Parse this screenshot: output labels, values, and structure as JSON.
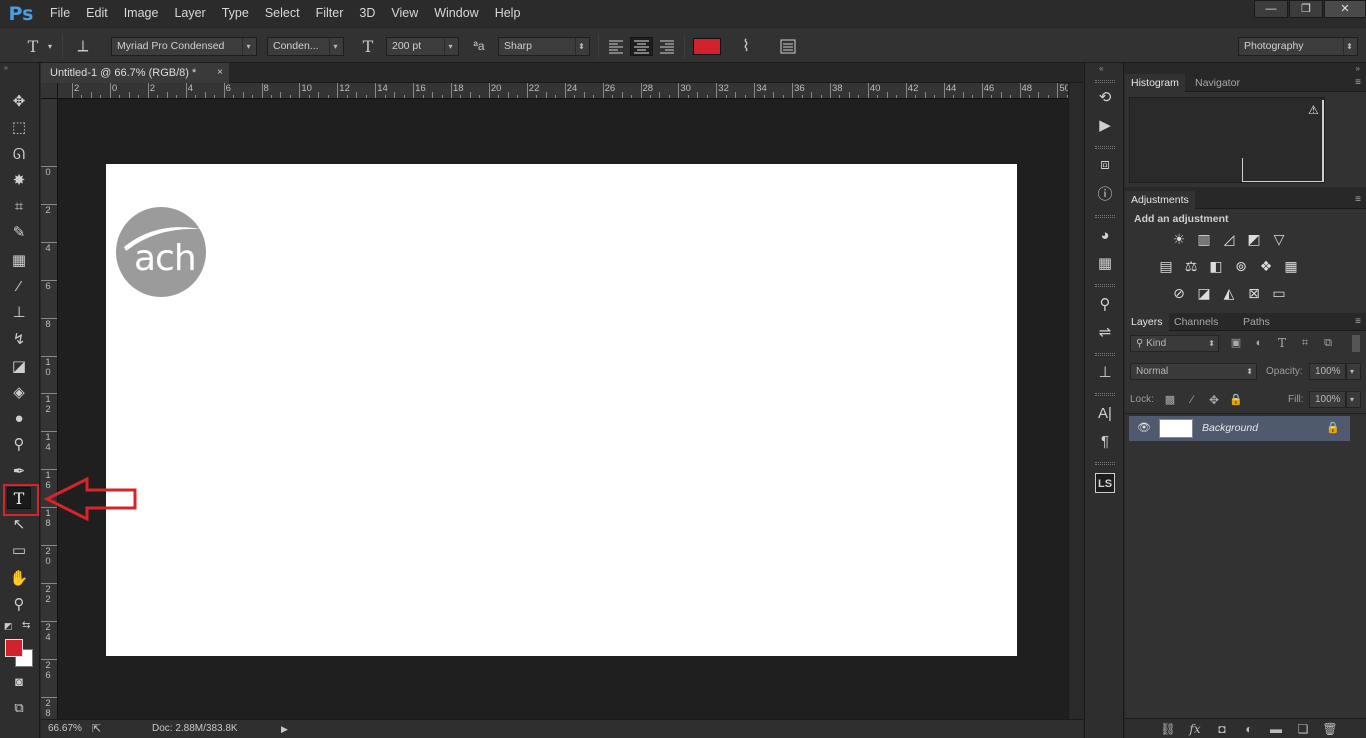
{
  "app": {
    "logo": "Ps",
    "menu": [
      "File",
      "Edit",
      "Image",
      "Layer",
      "Type",
      "Select",
      "Filter",
      "3D",
      "View",
      "Window",
      "Help"
    ],
    "window_controls": {
      "minimize": "—",
      "restore": "❐",
      "close": "✕"
    }
  },
  "options_bar": {
    "tool_icon": "T",
    "font_family": "Myriad Pro Condensed",
    "font_style": "Conden...",
    "font_size": "200 pt",
    "aa_label": "ªa",
    "antialias": "Sharp",
    "text_color": "#d1212b",
    "workspace": "Photography"
  },
  "document": {
    "tab_title": "Untitled-1 @ 66.7% (RGB/8) *",
    "close": "×",
    "ruler_h": [
      "2",
      "0",
      "2",
      "4",
      "6",
      "8",
      "10",
      "12",
      "14",
      "16",
      "18",
      "20",
      "22",
      "24",
      "26",
      "28",
      "30",
      "32",
      "34",
      "36",
      "38",
      "40",
      "42",
      "44",
      "46",
      "48",
      "50"
    ],
    "ruler_v": [
      "0",
      "2",
      "4",
      "6",
      "8",
      "1\n0",
      "1\n2",
      "1\n4",
      "1\n6",
      "1\n8",
      "2\n0",
      "2\n2",
      "2\n4",
      "2\n6",
      "2\n8"
    ],
    "logo_text": "ach"
  },
  "status": {
    "zoom": "66.67%",
    "doc_info": "Doc: 2.88M/383.8K"
  },
  "panels": {
    "histogram": {
      "tabs": [
        "Histogram",
        "Navigator"
      ],
      "warning": "⚠"
    },
    "adjustments": {
      "tab": "Adjustments",
      "title": "Add an adjustment"
    },
    "layers": {
      "tabs": [
        "Layers",
        "Channels",
        "Paths"
      ],
      "filter_kind": "Kind",
      "blend_mode": "Normal",
      "opacity_label": "Opacity:",
      "opacity_value": "100%",
      "lock_label": "Lock:",
      "fill_label": "Fill:",
      "fill_value": "100%",
      "layer_name": "Background"
    }
  }
}
